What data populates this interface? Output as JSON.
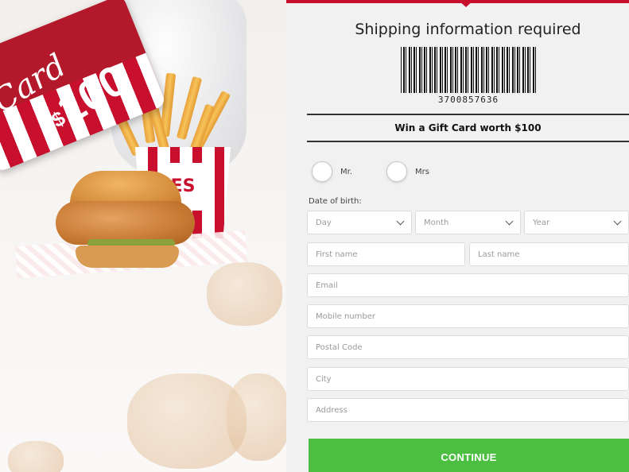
{
  "promo": {
    "card_script": "Card",
    "card_amount": "100",
    "card_currency": "$",
    "fries_box_label": "ES"
  },
  "form": {
    "heading": "Shipping information required",
    "barcode_number": "3700857636",
    "banner": "Win a Gift Card worth $100",
    "title_options": [
      "Mr.",
      "Mrs"
    ],
    "dob_label": "Date of birth:",
    "dob": {
      "day_placeholder": "Day",
      "month_placeholder": "Month",
      "year_placeholder": "Year"
    },
    "fields": {
      "first_name": "First name",
      "last_name": "Last name",
      "email": "Email",
      "mobile": "Mobile number",
      "postal_code": "Postal Code",
      "city": "City",
      "address": "Address"
    },
    "submit_label": "CONTINUE"
  },
  "colors": {
    "brand_red": "#c8102e",
    "continue_green": "#4cbf43"
  }
}
